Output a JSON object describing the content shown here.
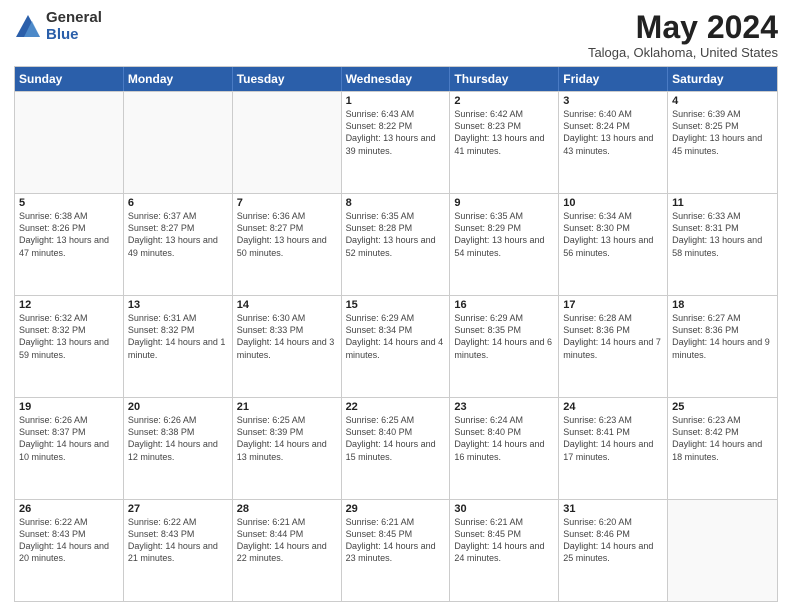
{
  "logo": {
    "general": "General",
    "blue": "Blue"
  },
  "title": {
    "month_year": "May 2024",
    "location": "Taloga, Oklahoma, United States"
  },
  "days_of_week": [
    "Sunday",
    "Monday",
    "Tuesday",
    "Wednesday",
    "Thursday",
    "Friday",
    "Saturday"
  ],
  "weeks": [
    [
      {
        "day": "",
        "sunrise": "",
        "sunset": "",
        "daylight": "",
        "empty": true
      },
      {
        "day": "",
        "sunrise": "",
        "sunset": "",
        "daylight": "",
        "empty": true
      },
      {
        "day": "",
        "sunrise": "",
        "sunset": "",
        "daylight": "",
        "empty": true
      },
      {
        "day": "1",
        "sunrise": "Sunrise: 6:43 AM",
        "sunset": "Sunset: 8:22 PM",
        "daylight": "Daylight: 13 hours and 39 minutes.",
        "empty": false
      },
      {
        "day": "2",
        "sunrise": "Sunrise: 6:42 AM",
        "sunset": "Sunset: 8:23 PM",
        "daylight": "Daylight: 13 hours and 41 minutes.",
        "empty": false
      },
      {
        "day": "3",
        "sunrise": "Sunrise: 6:40 AM",
        "sunset": "Sunset: 8:24 PM",
        "daylight": "Daylight: 13 hours and 43 minutes.",
        "empty": false
      },
      {
        "day": "4",
        "sunrise": "Sunrise: 6:39 AM",
        "sunset": "Sunset: 8:25 PM",
        "daylight": "Daylight: 13 hours and 45 minutes.",
        "empty": false
      }
    ],
    [
      {
        "day": "5",
        "sunrise": "Sunrise: 6:38 AM",
        "sunset": "Sunset: 8:26 PM",
        "daylight": "Daylight: 13 hours and 47 minutes.",
        "empty": false
      },
      {
        "day": "6",
        "sunrise": "Sunrise: 6:37 AM",
        "sunset": "Sunset: 8:27 PM",
        "daylight": "Daylight: 13 hours and 49 minutes.",
        "empty": false
      },
      {
        "day": "7",
        "sunrise": "Sunrise: 6:36 AM",
        "sunset": "Sunset: 8:27 PM",
        "daylight": "Daylight: 13 hours and 50 minutes.",
        "empty": false
      },
      {
        "day": "8",
        "sunrise": "Sunrise: 6:35 AM",
        "sunset": "Sunset: 8:28 PM",
        "daylight": "Daylight: 13 hours and 52 minutes.",
        "empty": false
      },
      {
        "day": "9",
        "sunrise": "Sunrise: 6:35 AM",
        "sunset": "Sunset: 8:29 PM",
        "daylight": "Daylight: 13 hours and 54 minutes.",
        "empty": false
      },
      {
        "day": "10",
        "sunrise": "Sunrise: 6:34 AM",
        "sunset": "Sunset: 8:30 PM",
        "daylight": "Daylight: 13 hours and 56 minutes.",
        "empty": false
      },
      {
        "day": "11",
        "sunrise": "Sunrise: 6:33 AM",
        "sunset": "Sunset: 8:31 PM",
        "daylight": "Daylight: 13 hours and 58 minutes.",
        "empty": false
      }
    ],
    [
      {
        "day": "12",
        "sunrise": "Sunrise: 6:32 AM",
        "sunset": "Sunset: 8:32 PM",
        "daylight": "Daylight: 13 hours and 59 minutes.",
        "empty": false
      },
      {
        "day": "13",
        "sunrise": "Sunrise: 6:31 AM",
        "sunset": "Sunset: 8:32 PM",
        "daylight": "Daylight: 14 hours and 1 minute.",
        "empty": false
      },
      {
        "day": "14",
        "sunrise": "Sunrise: 6:30 AM",
        "sunset": "Sunset: 8:33 PM",
        "daylight": "Daylight: 14 hours and 3 minutes.",
        "empty": false
      },
      {
        "day": "15",
        "sunrise": "Sunrise: 6:29 AM",
        "sunset": "Sunset: 8:34 PM",
        "daylight": "Daylight: 14 hours and 4 minutes.",
        "empty": false
      },
      {
        "day": "16",
        "sunrise": "Sunrise: 6:29 AM",
        "sunset": "Sunset: 8:35 PM",
        "daylight": "Daylight: 14 hours and 6 minutes.",
        "empty": false
      },
      {
        "day": "17",
        "sunrise": "Sunrise: 6:28 AM",
        "sunset": "Sunset: 8:36 PM",
        "daylight": "Daylight: 14 hours and 7 minutes.",
        "empty": false
      },
      {
        "day": "18",
        "sunrise": "Sunrise: 6:27 AM",
        "sunset": "Sunset: 8:36 PM",
        "daylight": "Daylight: 14 hours and 9 minutes.",
        "empty": false
      }
    ],
    [
      {
        "day": "19",
        "sunrise": "Sunrise: 6:26 AM",
        "sunset": "Sunset: 8:37 PM",
        "daylight": "Daylight: 14 hours and 10 minutes.",
        "empty": false
      },
      {
        "day": "20",
        "sunrise": "Sunrise: 6:26 AM",
        "sunset": "Sunset: 8:38 PM",
        "daylight": "Daylight: 14 hours and 12 minutes.",
        "empty": false
      },
      {
        "day": "21",
        "sunrise": "Sunrise: 6:25 AM",
        "sunset": "Sunset: 8:39 PM",
        "daylight": "Daylight: 14 hours and 13 minutes.",
        "empty": false
      },
      {
        "day": "22",
        "sunrise": "Sunrise: 6:25 AM",
        "sunset": "Sunset: 8:40 PM",
        "daylight": "Daylight: 14 hours and 15 minutes.",
        "empty": false
      },
      {
        "day": "23",
        "sunrise": "Sunrise: 6:24 AM",
        "sunset": "Sunset: 8:40 PM",
        "daylight": "Daylight: 14 hours and 16 minutes.",
        "empty": false
      },
      {
        "day": "24",
        "sunrise": "Sunrise: 6:23 AM",
        "sunset": "Sunset: 8:41 PM",
        "daylight": "Daylight: 14 hours and 17 minutes.",
        "empty": false
      },
      {
        "day": "25",
        "sunrise": "Sunrise: 6:23 AM",
        "sunset": "Sunset: 8:42 PM",
        "daylight": "Daylight: 14 hours and 18 minutes.",
        "empty": false
      }
    ],
    [
      {
        "day": "26",
        "sunrise": "Sunrise: 6:22 AM",
        "sunset": "Sunset: 8:43 PM",
        "daylight": "Daylight: 14 hours and 20 minutes.",
        "empty": false
      },
      {
        "day": "27",
        "sunrise": "Sunrise: 6:22 AM",
        "sunset": "Sunset: 8:43 PM",
        "daylight": "Daylight: 14 hours and 21 minutes.",
        "empty": false
      },
      {
        "day": "28",
        "sunrise": "Sunrise: 6:21 AM",
        "sunset": "Sunset: 8:44 PM",
        "daylight": "Daylight: 14 hours and 22 minutes.",
        "empty": false
      },
      {
        "day": "29",
        "sunrise": "Sunrise: 6:21 AM",
        "sunset": "Sunset: 8:45 PM",
        "daylight": "Daylight: 14 hours and 23 minutes.",
        "empty": false
      },
      {
        "day": "30",
        "sunrise": "Sunrise: 6:21 AM",
        "sunset": "Sunset: 8:45 PM",
        "daylight": "Daylight: 14 hours and 24 minutes.",
        "empty": false
      },
      {
        "day": "31",
        "sunrise": "Sunrise: 6:20 AM",
        "sunset": "Sunset: 8:46 PM",
        "daylight": "Daylight: 14 hours and 25 minutes.",
        "empty": false
      },
      {
        "day": "",
        "sunrise": "",
        "sunset": "",
        "daylight": "",
        "empty": true
      }
    ]
  ]
}
